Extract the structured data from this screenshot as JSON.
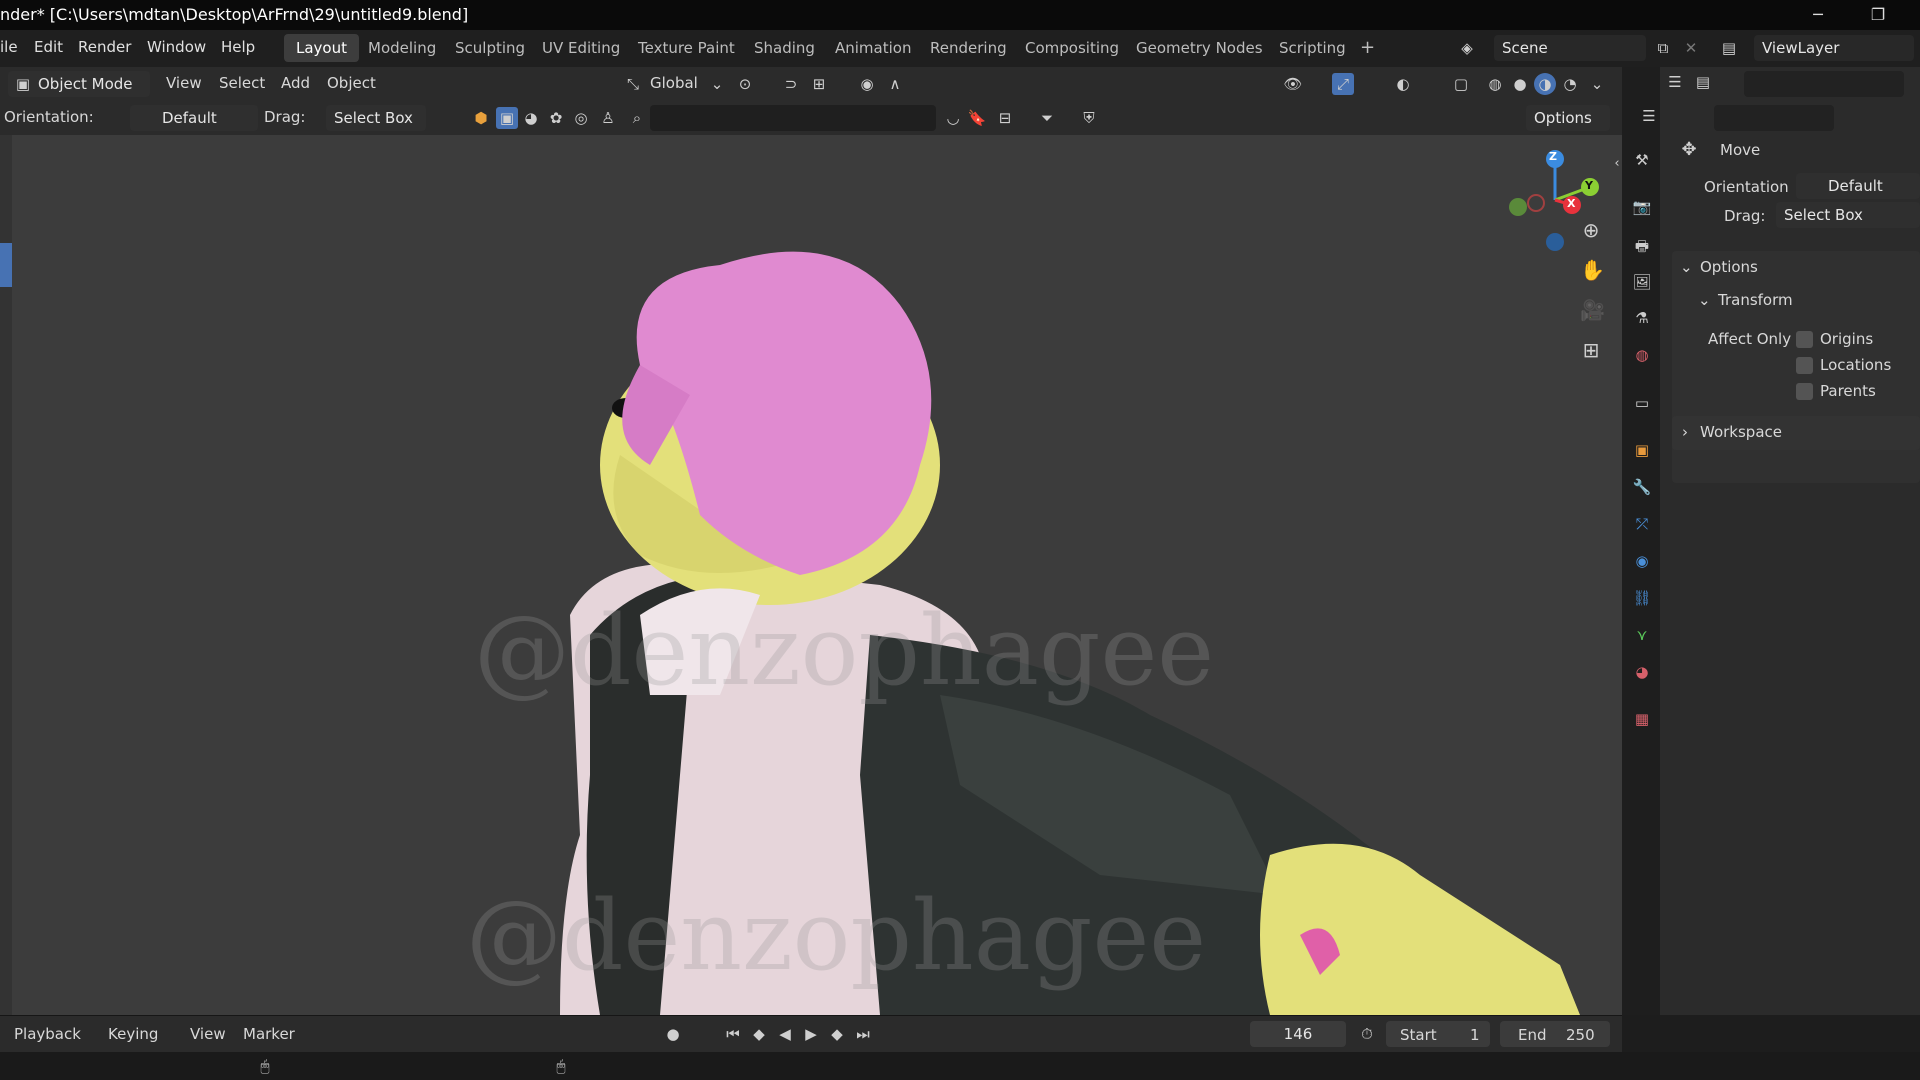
{
  "titlebar": {
    "title": "nder* [C:\\Users\\mdtan\\Desktop\\ArFrnd\\29\\untitled9.blend]",
    "minimize": "─",
    "restore": "❐"
  },
  "menubar": {
    "items": [
      "ile",
      "Edit",
      "Render",
      "Window",
      "Help"
    ],
    "workspaces": [
      "Layout",
      "Modeling",
      "Sculpting",
      "UV Editing",
      "Texture Paint",
      "Shading",
      "Animation",
      "Rendering",
      "Compositing",
      "Geometry Nodes",
      "Scripting"
    ],
    "add_workspace": "+",
    "scene": "Scene",
    "view_layer": "ViewLayer"
  },
  "viewport_header": {
    "mode": "Object Mode",
    "menus": [
      "View",
      "Select",
      "Add",
      "Object"
    ],
    "transform_orientation": "Global"
  },
  "tool_header": {
    "orientation_label": "Orientation:",
    "orientation_value": "Default",
    "drag_label": "Drag:",
    "drag_value": "Select Box",
    "options": "Options"
  },
  "viewport": {
    "watermark": "@denzophagee",
    "gizmo": {
      "z": "Z",
      "y": "Y",
      "x": "X"
    }
  },
  "properties": {
    "tool_name": "Move",
    "orientation_label": "Orientation",
    "orientation_value": "Default",
    "drag_label": "Drag:",
    "drag_value": "Select Box",
    "options_section": "Options",
    "transform_section": "Transform",
    "affect_only_label": "Affect Only",
    "affect_only": [
      "Origins",
      "Locations",
      "Parents"
    ],
    "workspace_section": "Workspace"
  },
  "timeline": {
    "menus": [
      "Playback",
      "Keying",
      "View",
      "Marker"
    ],
    "current_frame": "146",
    "start_label": "Start",
    "start_value": "1",
    "end_label": "End",
    "end_value": "250"
  },
  "colors": {
    "accent": "#4772b3",
    "gizmo_x": "#e8323c",
    "gizmo_y": "#8bcf33",
    "gizmo_z": "#3b8ce0",
    "hair": "#e08ad0",
    "fur": "#e3e07a"
  }
}
